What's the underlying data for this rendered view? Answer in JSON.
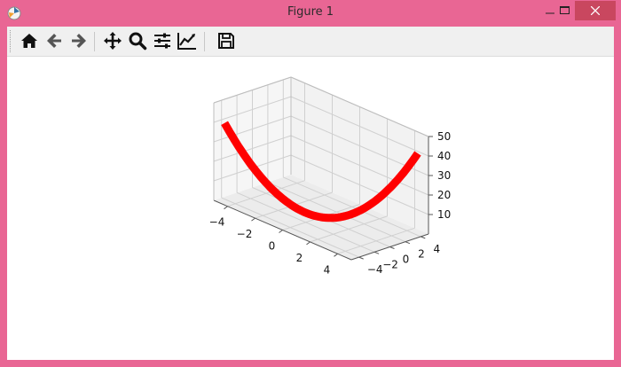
{
  "window": {
    "title": "Figure 1",
    "minimize_glyph": "🗕",
    "maximize_glyph": "🗖",
    "close_glyph": "✕"
  },
  "toolbar": {
    "buttons": [
      {
        "name": "home-icon"
      },
      {
        "name": "back-arrow-icon"
      },
      {
        "name": "forward-arrow-icon"
      },
      {
        "name": "pan-icon"
      },
      {
        "name": "zoom-icon"
      },
      {
        "name": "subplots-icon"
      },
      {
        "name": "axes-edit-icon"
      },
      {
        "name": "save-icon"
      }
    ]
  },
  "chart_data": {
    "type": "line",
    "projection": "3d",
    "x": [
      -4.5,
      -4,
      -3,
      -2,
      -1,
      0,
      1,
      2,
      3,
      4,
      4.5
    ],
    "y": [
      -4.5,
      -4,
      -3,
      -2,
      -1,
      0,
      1,
      2,
      3,
      4,
      4.5
    ],
    "z": [
      40.5,
      32,
      18,
      8,
      2,
      0,
      2,
      8,
      18,
      32,
      40.5
    ],
    "series": [
      {
        "color": "#ff0000"
      }
    ],
    "x_ticks": [
      "−4",
      "−2",
      "0",
      "2",
      "4"
    ],
    "y_ticks": [
      "−4",
      "−2",
      "0",
      "2",
      "4"
    ],
    "z_ticks": [
      "10",
      "20",
      "30",
      "40",
      "50"
    ],
    "xlim": [
      -5,
      5
    ],
    "ylim": [
      -5,
      5
    ],
    "zlim": [
      0,
      50
    ],
    "grid": true
  }
}
